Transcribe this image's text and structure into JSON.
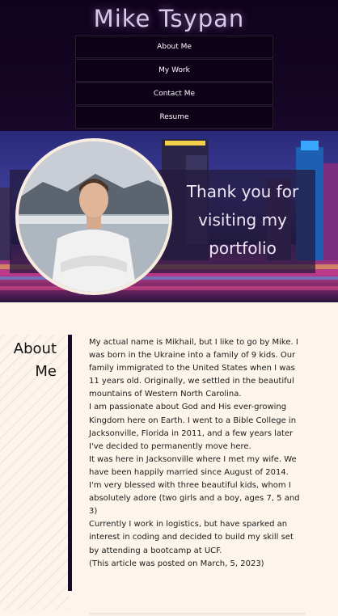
{
  "header": {
    "title": "Mike Tsypan",
    "nav": [
      {
        "label": "About Me"
      },
      {
        "label": "My Work"
      },
      {
        "label": "Contact Me"
      },
      {
        "label": "Resume"
      }
    ]
  },
  "hero": {
    "message": "Thank you for visiting my portfolio"
  },
  "about": {
    "heading_line1": "About",
    "heading_line2": "Me",
    "paragraphs": [
      "My actual name is Mikhail, but I like to go by Mike. I was born in the Ukraine into a family of 9 kids. Our family immigrated to the United States when I was 11 years old. Originally, we settled in the beautiful mountains of Western North Carolina.",
      "I am passionate about God and His ever-growing Kingdom here on Earth. I went to a Bible College in Jacksonville, Florida in 2011, and a few years later I've decided to permanently move here.",
      "It was here in Jacksonville where I met my wife. We have been happily married since August of 2014.",
      "I'm very blessed with three beautiful kids, whom I absolutely adore (two girls and a boy, ages 7, 5 and 3)",
      "Currently I work in logistics, but have sparked an interest in coding and decided to build my skill set by attending a bootcamp at UCF.",
      "(This article was posted on March, 5, 2023)"
    ]
  },
  "colors": {
    "header_bg": "#10031d",
    "page_bg": "#fdf5ec",
    "accent_bar": "#160b22"
  }
}
